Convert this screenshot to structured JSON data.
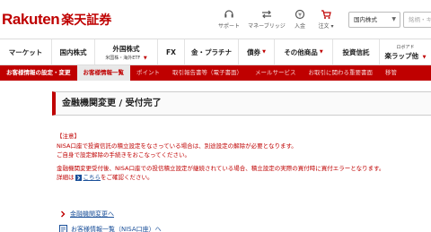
{
  "header": {
    "logo_en": "Rakuten",
    "logo_jp": "楽天証券",
    "utilities": [
      {
        "label": "サポート",
        "icon": "support-icon"
      },
      {
        "label": "マネーブリッジ",
        "icon": "money-bridge-icon"
      },
      {
        "label": "入金",
        "icon": "deposit-icon"
      },
      {
        "label": "注文",
        "icon": "cart-icon"
      }
    ],
    "search_category": "国内株式",
    "search_placeholder": "銘柄・キーワード"
  },
  "global_nav": [
    {
      "label": "マーケット",
      "sub": ""
    },
    {
      "label": "国内株式",
      "sub": ""
    },
    {
      "label": "外国株式",
      "sub": "米国株・海外ETF"
    },
    {
      "label": "FX",
      "sub": ""
    },
    {
      "label": "金・プラチナ",
      "sub": ""
    },
    {
      "label": "債券",
      "sub": ""
    },
    {
      "label": "その他商品",
      "sub": ""
    },
    {
      "label": "投資信託",
      "sub": ""
    },
    {
      "label": "ロボアド",
      "sub": "楽ラップ他"
    }
  ],
  "sub_nav": [
    {
      "label": "お客様情報の設定・変更"
    },
    {
      "label": "お客様情報一覧"
    },
    {
      "label": "ポイント"
    },
    {
      "label": "取引報告書等（電子書面）"
    },
    {
      "label": "メールサービス"
    },
    {
      "label": "お取引に関わる重要書面"
    },
    {
      "label": "移管"
    }
  ],
  "page": {
    "title": "金融機関変更 / 受付完了",
    "notice_heading": "【注意】",
    "notice_lines": [
      "NISA口座で投資信託の積立設定をなさっている場合は、別途設定の解除が必要となります。",
      "ご自身で設定解除の手続きをおこなってください。"
    ],
    "detail_lines": [
      "金融機関変更受付後、NISA口座での投信積立設定が継続されている場合、積立設定の実際の買付時に買付エラーとなります。"
    ],
    "detail_prefix": "詳細は",
    "detail_link": "こちら",
    "detail_suffix": "をご確認ください。",
    "links": [
      {
        "label": "金融機関変更へ"
      },
      {
        "label": "お客様情報一覧（NISA口座）へ"
      }
    ]
  }
}
